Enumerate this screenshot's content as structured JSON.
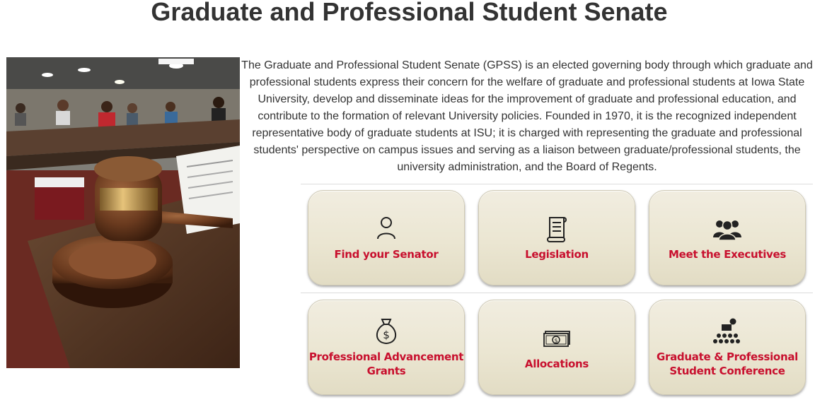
{
  "page": {
    "title": "Graduate and Professional Student Senate",
    "intro": "The Graduate and Professional Student Senate (GPSS) is an elected governing body through which graduate and professional students express their concern for the welfare of graduate and professional students at Iowa State University, develop and disseminate ideas for the improvement of graduate and professional education, and contribute to the formation of relevant University policies. Founded in 1970, it is the recognized independent representative body of graduate students at ISU; it is charged with representing the graduate and professional students' perspective on campus issues and serving as a liaison between graduate/professional students, the university administration, and the Board of Regents."
  },
  "tiles": [
    {
      "label": "Find your Senator",
      "icon": "person-icon"
    },
    {
      "label": "Legislation",
      "icon": "scroll-document-icon"
    },
    {
      "label": "Meet the Executives",
      "icon": "group-people-icon"
    },
    {
      "label": "Professional Advancement Grants",
      "icon": "money-bag-icon"
    },
    {
      "label": "Allocations",
      "icon": "cash-stack-icon"
    },
    {
      "label": "Graduate & Professional Student Conference",
      "icon": "presenter-audience-icon"
    }
  ],
  "colors": {
    "tile_label": "#c8102e",
    "tile_background": "#ebe6d2",
    "title_text": "#333333"
  }
}
